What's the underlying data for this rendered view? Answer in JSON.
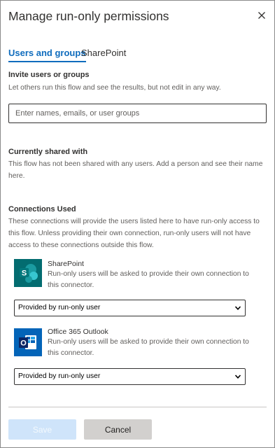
{
  "dialog": {
    "title": "Manage run-only permissions",
    "close_icon": "close-icon"
  },
  "tabs": [
    {
      "label": "Users and groups",
      "selected": true
    },
    {
      "label": "SharePoint",
      "selected": false
    }
  ],
  "invite": {
    "heading": "Invite users or groups",
    "description": "Let others run this flow and see the results, but not edit in any way.",
    "placeholder": "Enter names, emails, or user groups",
    "value": ""
  },
  "shared": {
    "heading": "Currently shared with",
    "description": "This flow has not been shared with any users. Add a person and see their name here."
  },
  "connections": {
    "heading": "Connections Used",
    "description": "These connections will provide the users listed here to have run-only access to this flow. Unless providing their own connection, run-only users will not have access to these connections outside this flow.",
    "items": [
      {
        "name": "SharePoint",
        "description": "Run-only users will be asked to provide their own connection to this connector.",
        "icon": "sharepoint-icon",
        "icon_color": "#036c70",
        "icon_letter": "S",
        "selected_option": "Provided by run-only user"
      },
      {
        "name": "Office 365 Outlook",
        "description": "Run-only users will be asked to provide their own connection to this connector.",
        "icon": "outlook-icon",
        "icon_color": "#0364b8",
        "icon_letter": "O",
        "selected_option": "Provided by run-only user"
      }
    ]
  },
  "footer": {
    "save_label": "Save",
    "save_enabled": false,
    "cancel_label": "Cancel"
  },
  "colors": {
    "accent": "#0f6cbd",
    "save_disabled_bg": "#cfe4fa",
    "cancel_bg": "#d2d0ce"
  }
}
